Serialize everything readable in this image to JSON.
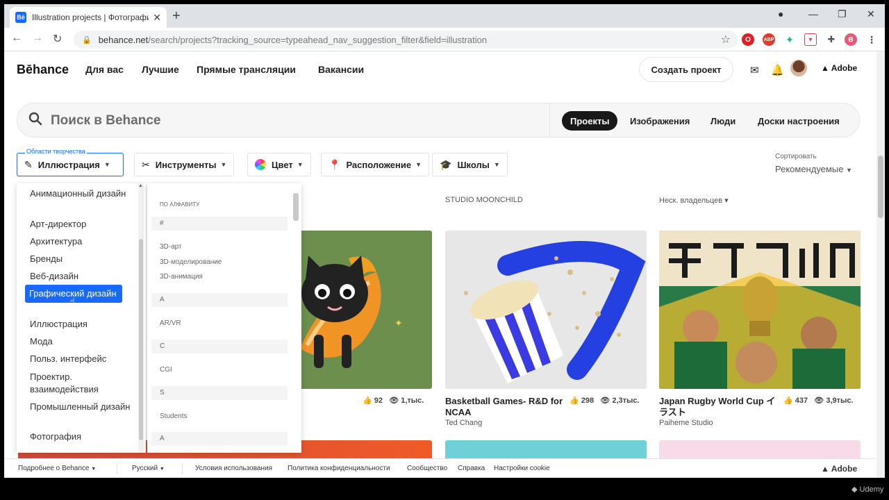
{
  "browser": {
    "tab_title": "Illustration projects | Фотографи",
    "tab_favicon": "Bē",
    "url_main": "behance.net",
    "url_rest": "/search/projects?tracking_source=typeahead_nav_suggestion_filter&field=illustration",
    "profile_initial": "B"
  },
  "header": {
    "logo": "Bēhance",
    "nav": [
      "Для вас",
      "Лучшие",
      "Прямые трансляции",
      "Вакансии"
    ],
    "create_label": "Создать проект",
    "adobe_label": "Adobe"
  },
  "search": {
    "placeholder": "Поиск в Behance",
    "tabs": [
      "Проекты",
      "Изображения",
      "Люди",
      "Доски настроения"
    ],
    "active_tab": "Проекты"
  },
  "filters": {
    "fields_label": "Области творчества",
    "fields_value": "Иллюстрация",
    "tools": "Инструменты",
    "color": "Цвет",
    "location": "Расположение",
    "schools": "Школы",
    "sort_label": "Сортировать",
    "sort_value": "Рекомендуемые"
  },
  "dropdown": {
    "fields": [
      "Анимационный дизайн",
      "Арт-директор",
      "Архитектура",
      "Бренды",
      "Веб-дизайн",
      "Графический дизайн",
      "Иллюстрация",
      "Мода",
      "Польз. интерфейс",
      "Проектир. взаимодействия",
      "Промышленный дизайн",
      "Фотография"
    ],
    "selected": "Графический дизайн",
    "alpha_header": "по алфавиту",
    "alpha_items": [
      {
        "t": "#",
        "grp": true
      },
      {
        "t": "3D-арт",
        "grp": false
      },
      {
        "t": "3D-моделирование",
        "grp": false
      },
      {
        "t": "3D-анимация",
        "grp": false
      },
      {
        "t": "A",
        "grp": true
      },
      {
        "t": "AR/VR",
        "grp": false
      },
      {
        "t": "C",
        "grp": true
      },
      {
        "t": "CGI",
        "grp": false
      },
      {
        "t": "S",
        "grp": true
      },
      {
        "t": "Students",
        "grp": false
      },
      {
        "t": "A",
        "grp": true
      }
    ]
  },
  "cards": [
    {
      "title": "",
      "owner": "",
      "likes": "92",
      "views": "1,тыс.",
      "top_owner": ""
    },
    {
      "title": "Basketball Games- R&D for NCAA",
      "owner": "Ted Chang",
      "likes": "298",
      "views": "2,3тыс.",
      "top_owner": "STUDIO MOONCHILD"
    },
    {
      "title": "Japan Rugby World Cup イラスト",
      "owner": "Paiheme Studio",
      "likes": "437",
      "views": "3,9тыс.",
      "top_owner": "Неск. владельцев ▾"
    }
  ],
  "footer": {
    "more": "Подробнее о Behance",
    "lang": "Русский",
    "links": [
      "Условия использования",
      "Политика конфиденциальности",
      "Сообщество",
      "Справка",
      "Настройки cookie"
    ],
    "adobe": "Adobe"
  },
  "watermark": "Udemy",
  "colors": {
    "accent": "#1769ff",
    "active_tab": "#191919"
  }
}
